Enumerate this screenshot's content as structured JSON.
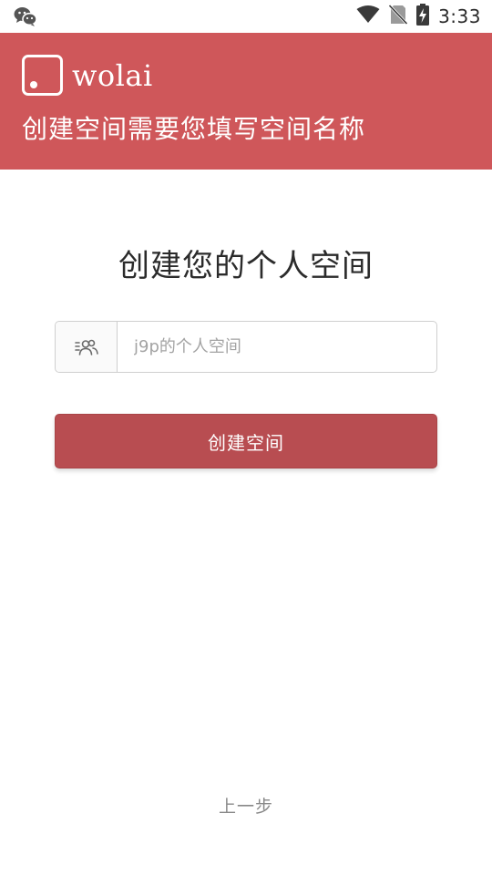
{
  "status_bar": {
    "time": "3:33",
    "icons": [
      "wechat-icon",
      "wifi-icon",
      "no-sim-icon",
      "battery-charging-icon"
    ]
  },
  "header": {
    "logo_text": "wolai",
    "subtitle": "创建空间需要您填写空间名称",
    "background_color": "#cf575a"
  },
  "main": {
    "title": "创建您的个人空间",
    "input": {
      "value": "",
      "placeholder": "j9p的个人空间",
      "icon": "team-icon"
    },
    "create_button_label": "创建空间",
    "button_color": "#b84d51"
  },
  "footer": {
    "back_label": "上一步"
  }
}
